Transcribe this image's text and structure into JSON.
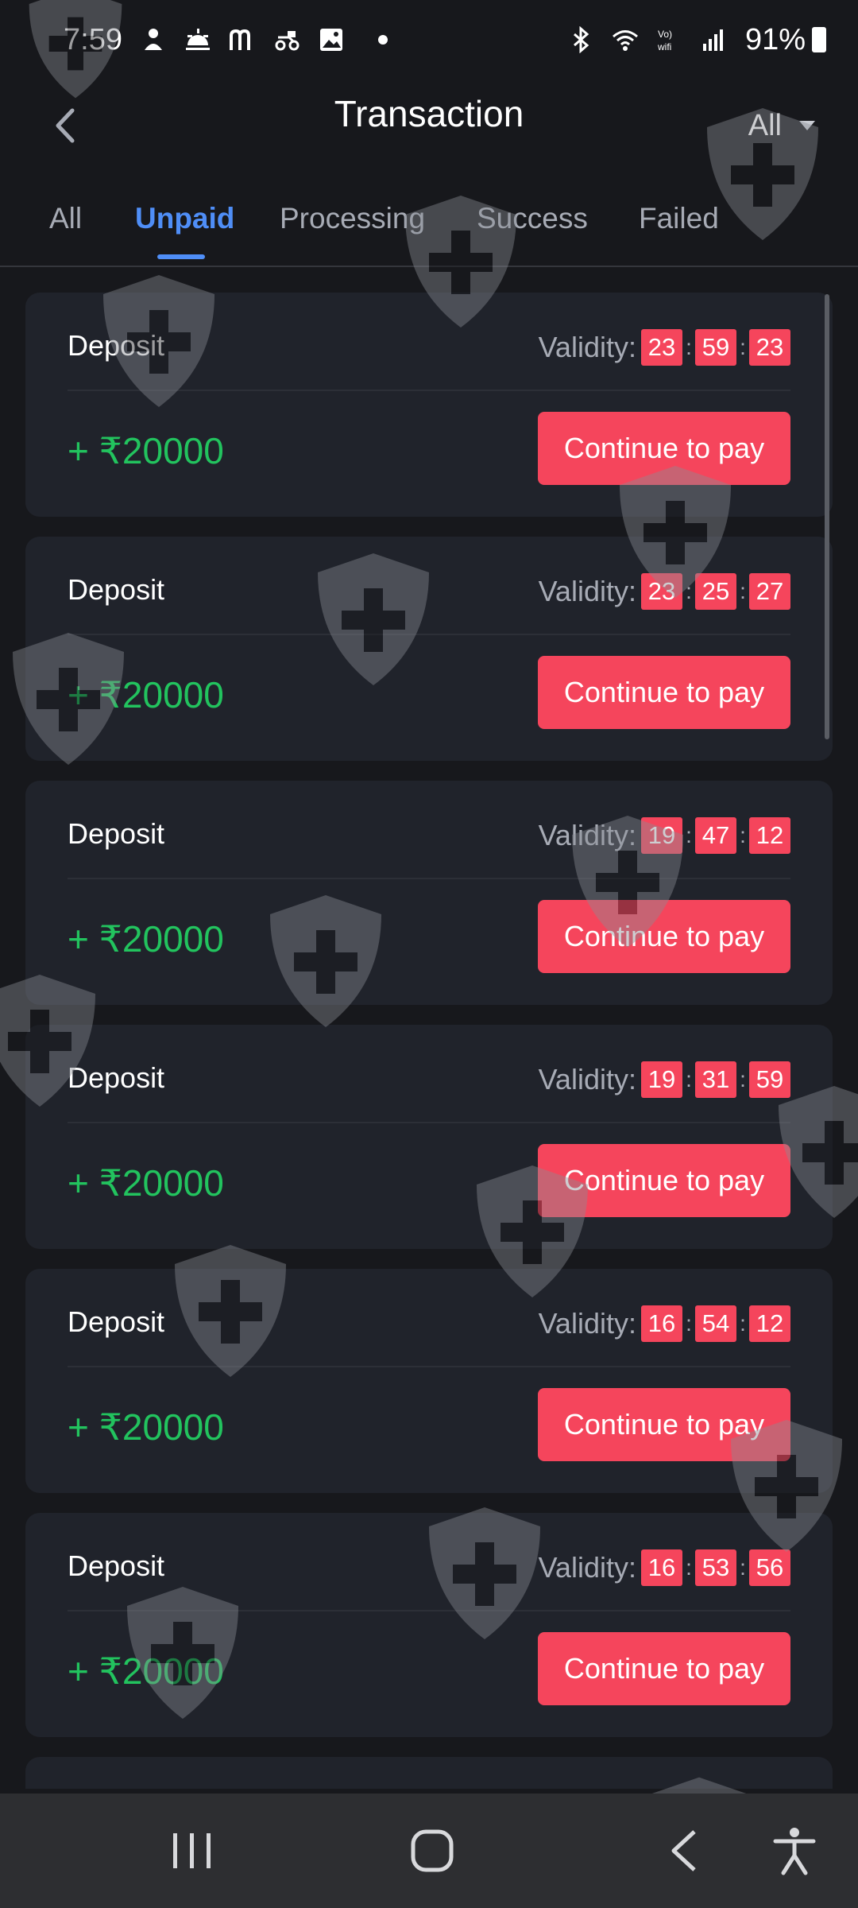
{
  "status_bar": {
    "time": "7:59",
    "battery": "91%",
    "left_icons": [
      "person-icon",
      "sunrise-icon",
      "m-app-icon",
      "delivery-icon",
      "image-icon",
      "dot-icon"
    ],
    "right_icons": [
      "bluetooth-icon",
      "wifi-icon",
      "vowifi-icon",
      "signal-icon",
      "battery-icon"
    ]
  },
  "header": {
    "title": "Transaction",
    "filter_value": "All"
  },
  "tabs": [
    {
      "label": "All",
      "active": false
    },
    {
      "label": "Unpaid",
      "active": true
    },
    {
      "label": "Processing",
      "active": false
    },
    {
      "label": "Success",
      "active": false
    },
    {
      "label": "Failed",
      "active": false
    }
  ],
  "validity_label": "Validity",
  "separator": ":",
  "transactions": [
    {
      "type": "Deposit",
      "amount": "+ ₹20000",
      "timer": [
        "23",
        "59",
        "23"
      ],
      "action": "Continue to pay"
    },
    {
      "type": "Deposit",
      "amount": "+ ₹20000",
      "timer": [
        "23",
        "25",
        "27"
      ],
      "action": "Continue to pay"
    },
    {
      "type": "Deposit",
      "amount": "+ ₹20000",
      "timer": [
        "19",
        "47",
        "12"
      ],
      "action": "Continue to pay"
    },
    {
      "type": "Deposit",
      "amount": "+ ₹20000",
      "timer": [
        "19",
        "31",
        "59"
      ],
      "action": "Continue to pay"
    },
    {
      "type": "Deposit",
      "amount": "+ ₹20000",
      "timer": [
        "16",
        "54",
        "12"
      ],
      "action": "Continue to pay"
    },
    {
      "type": "Deposit",
      "amount": "+ ₹20000",
      "timer": [
        "16",
        "53",
        "56"
      ],
      "action": "Continue to pay"
    }
  ],
  "colors": {
    "background": "#17181c",
    "card": "#20232b",
    "accent_blue": "#4f8ef7",
    "pay_red": "#f5455c",
    "amount_green": "#22c35e"
  },
  "navbar": {
    "icons": [
      "recent-apps-icon",
      "home-icon",
      "back-icon",
      "accessibility-icon"
    ]
  }
}
